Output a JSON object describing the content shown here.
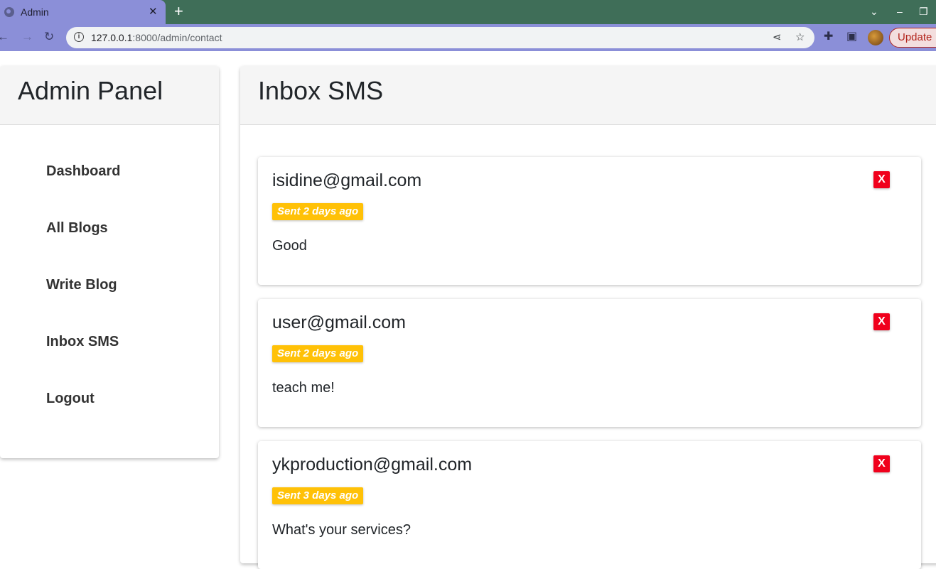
{
  "browser": {
    "tab_title": "Admin",
    "tab_close": "✕",
    "new_tab": "+",
    "url_host": "127.0.0.1",
    "url_path": ":8000/admin/contact",
    "update_label": "Update",
    "icons": [
      "site-info-icon",
      "share-icon",
      "bookmark-star-icon",
      "extensions-icon",
      "side-panel-icon",
      "profile-avatar"
    ]
  },
  "sidebar": {
    "title": "Admin Panel",
    "items": [
      {
        "label": "Dashboard"
      },
      {
        "label": "All Blogs"
      },
      {
        "label": "Write Blog"
      },
      {
        "label": "Inbox SMS"
      },
      {
        "label": "Logout"
      }
    ]
  },
  "main": {
    "title": "Inbox SMS",
    "messages": [
      {
        "email": "isidine@gmail.com",
        "sent": "Sent 2 days ago",
        "body": "Good",
        "delete_label": "X"
      },
      {
        "email": "user@gmail.com",
        "sent": "Sent 2 days ago",
        "body": "teach me!",
        "delete_label": "X"
      },
      {
        "email": "ykproduction@gmail.com",
        "sent": "Sent 3 days ago",
        "body": "What's your services?",
        "delete_label": "X"
      }
    ]
  },
  "colors": {
    "badge": "#ffc107",
    "delete": "#f0001c",
    "tab_bar": "#3f6e58",
    "toolbar": "#8b8fd8"
  }
}
